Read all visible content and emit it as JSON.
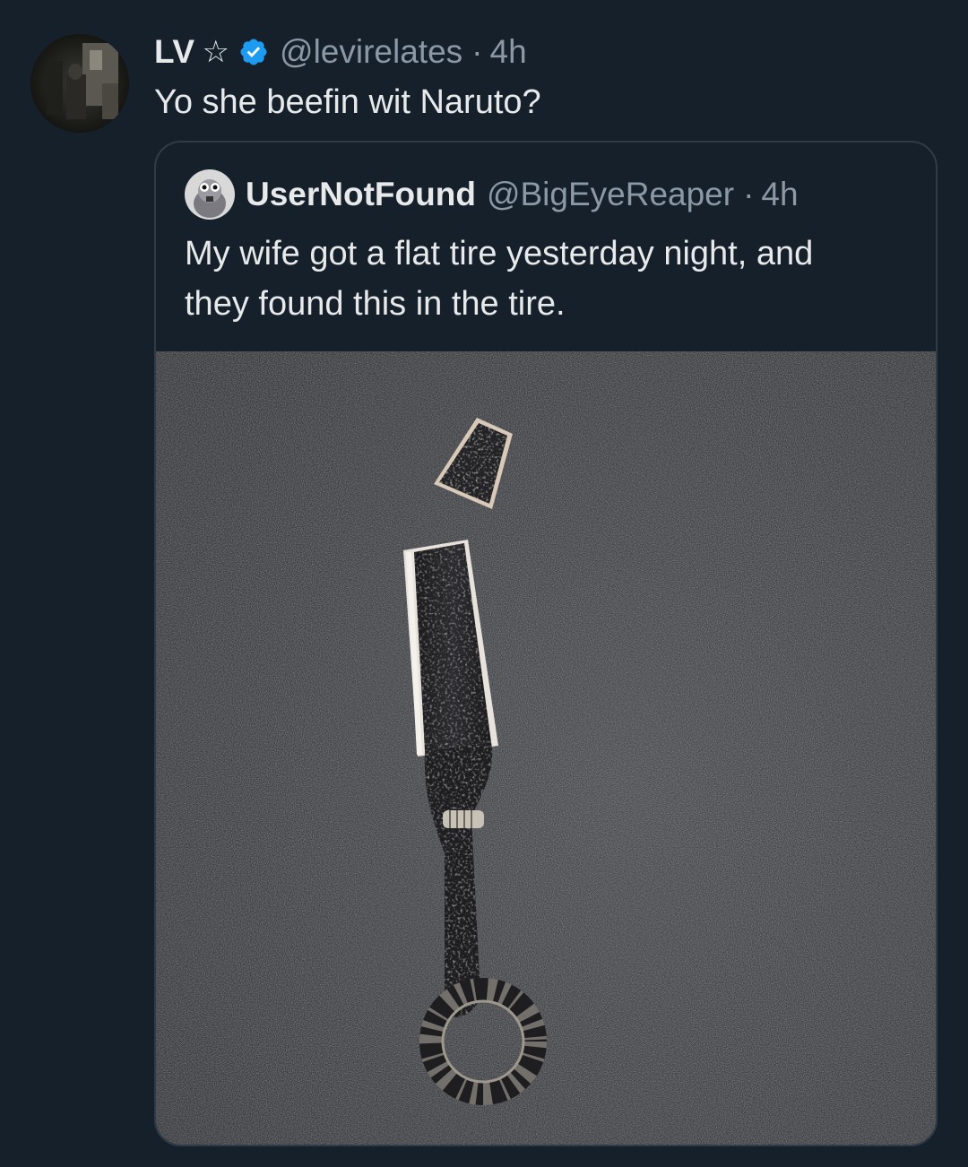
{
  "tweet": {
    "display_name": "LV",
    "star_icon": "star-icon",
    "verified_icon": "verified-badge-icon",
    "handle": "@levirelates",
    "separator": "·",
    "time": "4h",
    "text": "Yo she beefin wit Naruto?"
  },
  "quoted_tweet": {
    "display_name": "UserNotFound",
    "handle": "@BigEyeReaper",
    "separator": "·",
    "time": "4h",
    "text_lines": [
      "My wife got a flat tire yesterday night, and",
      "they found this in the tire."
    ],
    "media": "photo of a broken kunai knife on dark asphalt"
  },
  "colors": {
    "background": "#15202b",
    "primary_text": "#e7e9ea",
    "secondary_text": "#8b98a5",
    "verified_blue": "#1d9bf0",
    "card_border": "#2f3b47"
  }
}
